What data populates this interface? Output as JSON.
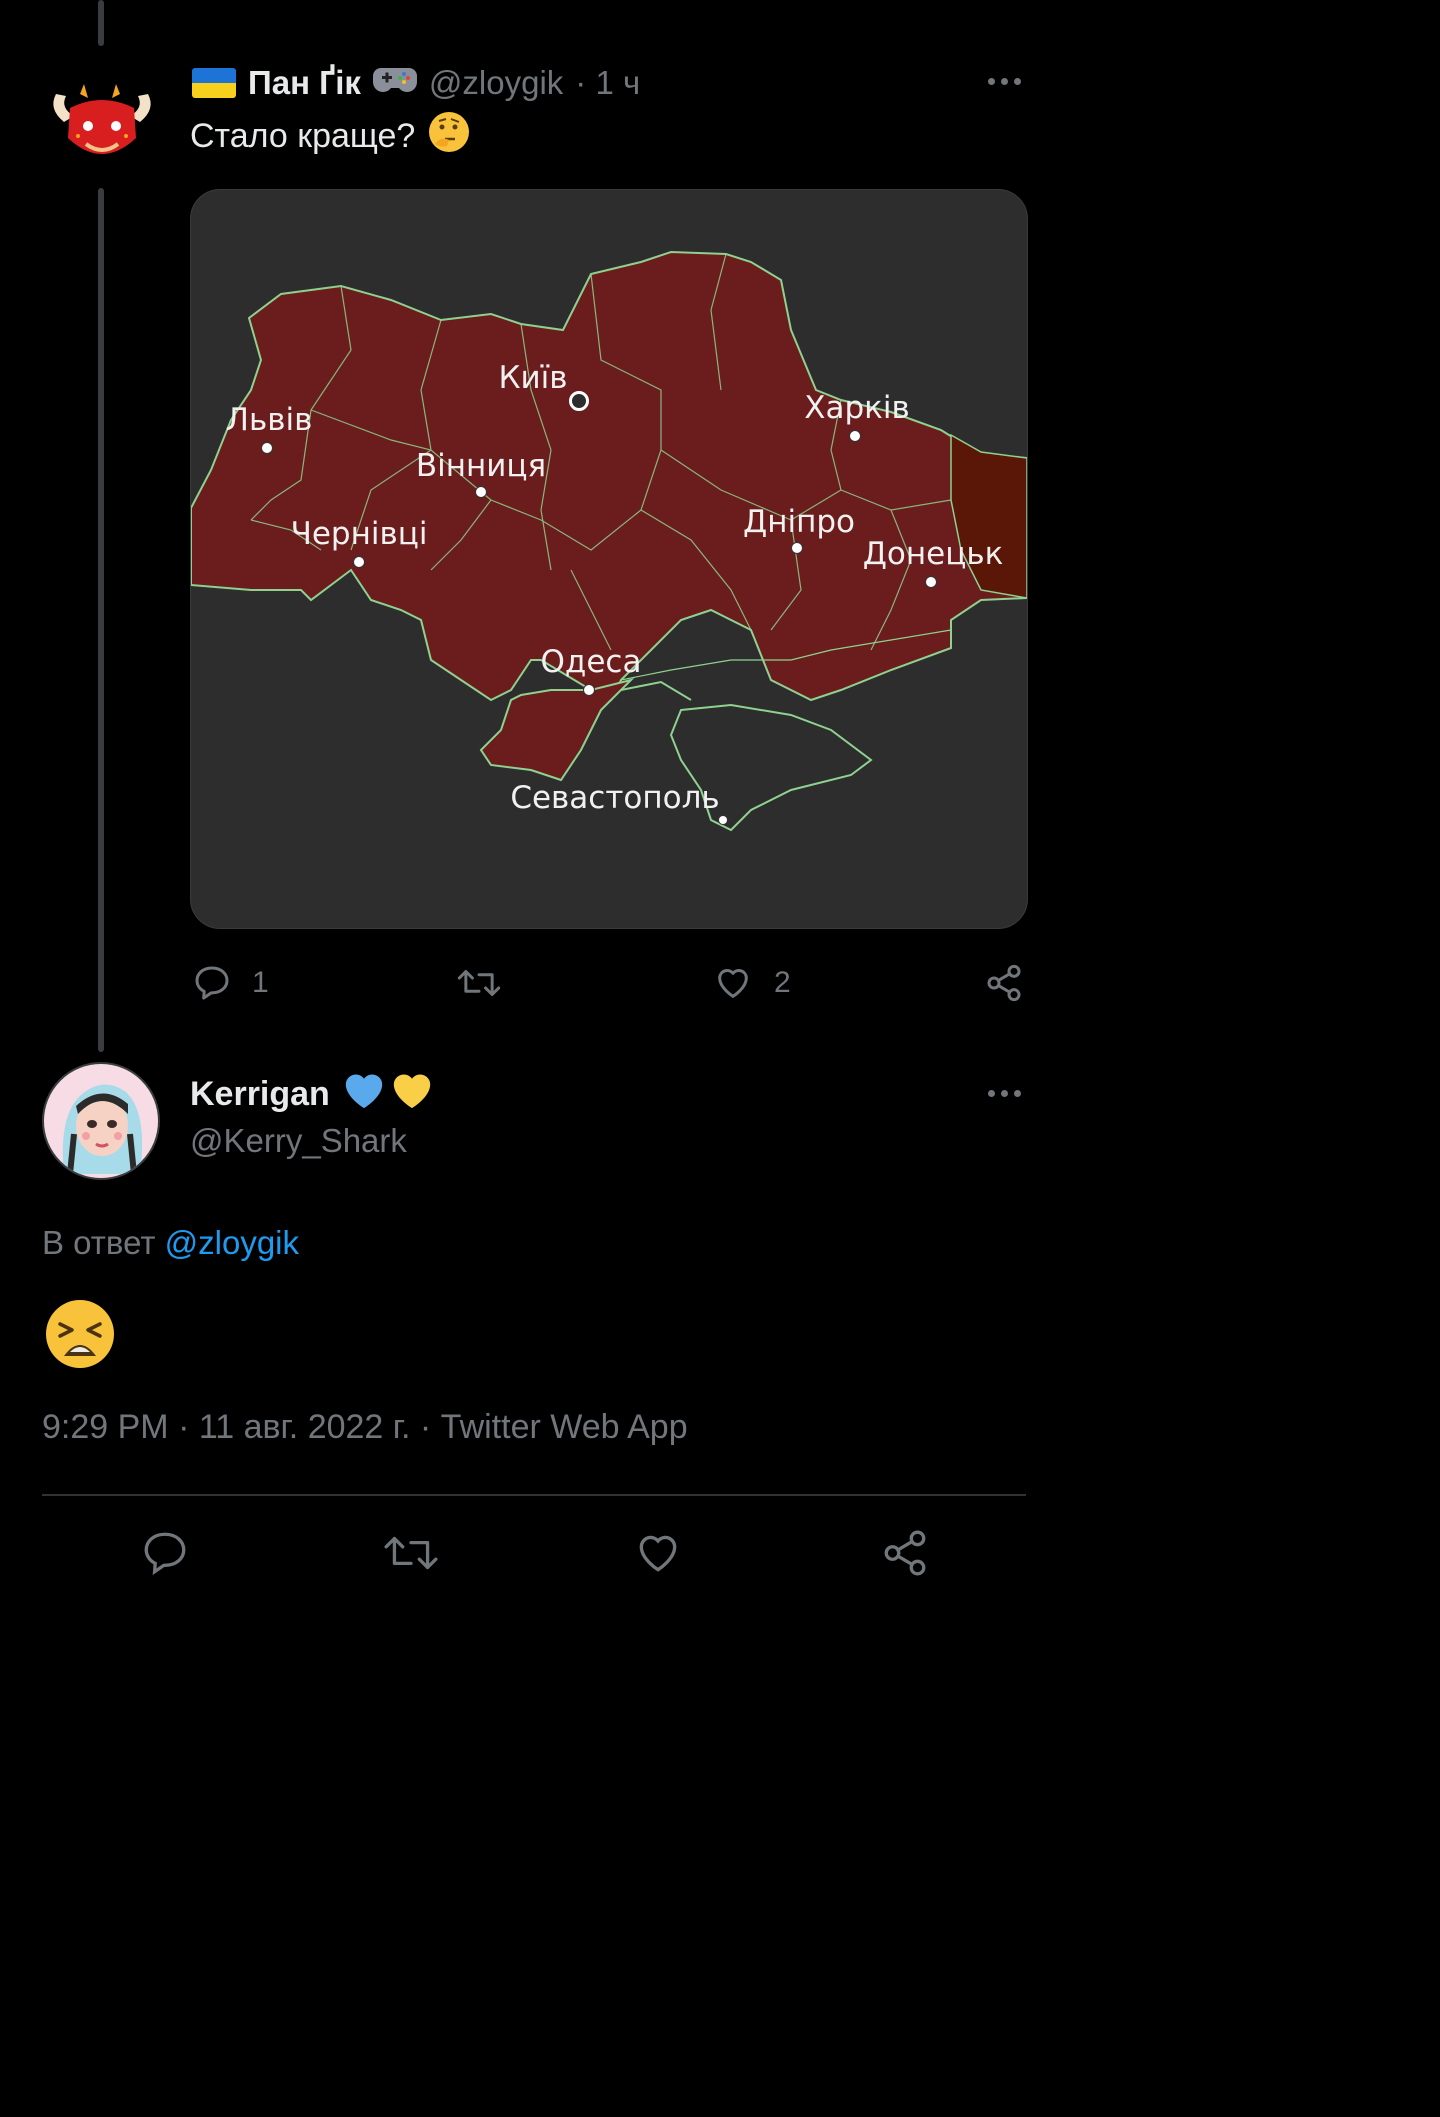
{
  "tweet": {
    "author_name": "Пан Ґік",
    "author_handle": "@zloygik",
    "time": "· 1 ч",
    "text": "Стало краще?",
    "reply_count": "1",
    "like_count": "2",
    "map_labels": {
      "kyiv": "Київ",
      "lviv": "Львів",
      "vinnytsia": "Вінниця",
      "kharkiv": "Харків",
      "chernivtsi": "Чернівці",
      "dnipro": "Дніпро",
      "donetsk": "Донецьк",
      "odesa": "Одеса",
      "sevastopol": "Севастополь"
    }
  },
  "reply": {
    "author_name": "Kerrigan",
    "author_handle": "@Kerry_Shark",
    "reply_prefix": "В ответ",
    "reply_to": "@zloygik",
    "meta": "9:29 PM · 11 авг. 2022 г. · Twitter Web App"
  },
  "colors": {
    "background": "#000000",
    "accent": "#1d9bf0",
    "muted": "#71767b",
    "region_fill": "#6e1c1c",
    "border_line": "#8fd18f"
  },
  "icons": [
    "reply-icon",
    "retweet-icon",
    "like-icon",
    "share-icon",
    "more-icon",
    "thinking-face-emoji",
    "weary-face-emoji",
    "gamepad-icon",
    "ukraine-flag-icon"
  ]
}
